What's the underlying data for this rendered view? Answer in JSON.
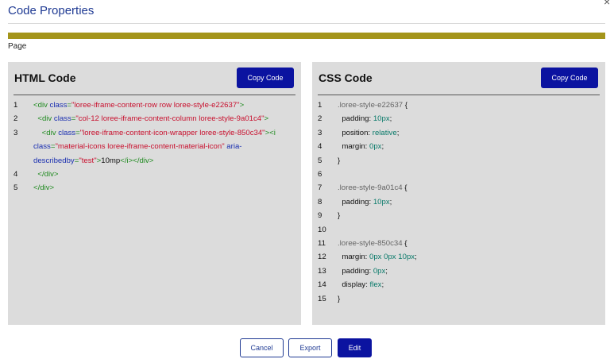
{
  "dialog": {
    "title": "Code Properties",
    "close_glyph": "×",
    "section_label": "Page",
    "accent_color": "#a4951a"
  },
  "html_panel": {
    "title": "HTML Code",
    "copy_label": "Copy Code",
    "lines": [
      {
        "n": "1",
        "seg": [
          [
            "t",
            "<div "
          ],
          [
            "a",
            "class"
          ],
          [
            "t",
            "="
          ],
          [
            "v",
            "\"loree-iframe-content-row row loree-style-e22637\""
          ],
          [
            "t",
            ">"
          ]
        ]
      },
      {
        "n": "2",
        "seg": [
          [
            "t",
            "  <div "
          ],
          [
            "a",
            "class"
          ],
          [
            "t",
            "="
          ],
          [
            "v",
            "\"col-12 loree-iframe-content-column loree-style-9a01c4\""
          ],
          [
            "t",
            ">"
          ]
        ]
      },
      {
        "n": "3",
        "seg": [
          [
            "t",
            "    <div "
          ],
          [
            "a",
            "class"
          ],
          [
            "t",
            "="
          ],
          [
            "v",
            "\"loree-iframe-content-icon-wrapper loree-style-850c34\""
          ],
          [
            "t",
            "><i "
          ],
          [
            "a",
            "class"
          ],
          [
            "t",
            "="
          ],
          [
            "v",
            "\"material-icons loree-iframe-content-material-icon\""
          ],
          [
            "a",
            " aria-describedby"
          ],
          [
            "t",
            "="
          ],
          [
            "v",
            "\"test\""
          ],
          [
            "t",
            ">"
          ],
          [
            "x",
            "10mp"
          ],
          [
            "t",
            "</i></div>"
          ]
        ]
      },
      {
        "n": "4",
        "seg": [
          [
            "t",
            "  </div>"
          ]
        ]
      },
      {
        "n": "5",
        "seg": [
          [
            "t",
            "</div>"
          ]
        ]
      }
    ]
  },
  "css_panel": {
    "title": "CSS Code",
    "copy_label": "Copy Code",
    "lines": [
      {
        "n": "1",
        "seg": [
          [
            "s",
            ".loree-style-e22637 "
          ],
          [
            "p",
            "{"
          ]
        ]
      },
      {
        "n": "2",
        "seg": [
          [
            "p",
            "  padding: "
          ],
          [
            "c",
            "10px"
          ],
          [
            "p",
            ";"
          ]
        ]
      },
      {
        "n": "3",
        "seg": [
          [
            "p",
            "  position: "
          ],
          [
            "c",
            "relative"
          ],
          [
            "p",
            ";"
          ]
        ]
      },
      {
        "n": "4",
        "seg": [
          [
            "p",
            "  margin: "
          ],
          [
            "c",
            "0px"
          ],
          [
            "p",
            ";"
          ]
        ]
      },
      {
        "n": "5",
        "seg": [
          [
            "p",
            "}"
          ]
        ]
      },
      {
        "n": "6",
        "seg": []
      },
      {
        "n": "7",
        "seg": [
          [
            "s",
            ".loree-style-9a01c4 "
          ],
          [
            "p",
            "{"
          ]
        ]
      },
      {
        "n": "8",
        "seg": [
          [
            "p",
            "  padding: "
          ],
          [
            "c",
            "10px"
          ],
          [
            "p",
            ";"
          ]
        ]
      },
      {
        "n": "9",
        "seg": [
          [
            "p",
            "}"
          ]
        ]
      },
      {
        "n": "10",
        "seg": []
      },
      {
        "n": "11",
        "seg": [
          [
            "s",
            ".loree-style-850c34 "
          ],
          [
            "p",
            "{"
          ]
        ]
      },
      {
        "n": "12",
        "seg": [
          [
            "p",
            "  margin: "
          ],
          [
            "c",
            "0px 0px 10px"
          ],
          [
            "p",
            ";"
          ]
        ]
      },
      {
        "n": "13",
        "seg": [
          [
            "p",
            "  padding: "
          ],
          [
            "c",
            "0px"
          ],
          [
            "p",
            ";"
          ]
        ]
      },
      {
        "n": "14",
        "seg": [
          [
            "p",
            "  display: "
          ],
          [
            "c",
            "flex"
          ],
          [
            "p",
            ";"
          ]
        ]
      },
      {
        "n": "15",
        "seg": [
          [
            "p",
            "}"
          ]
        ]
      }
    ]
  },
  "footer": {
    "cancel_label": "Cancel",
    "export_label": "Export",
    "edit_label": "Edit"
  }
}
